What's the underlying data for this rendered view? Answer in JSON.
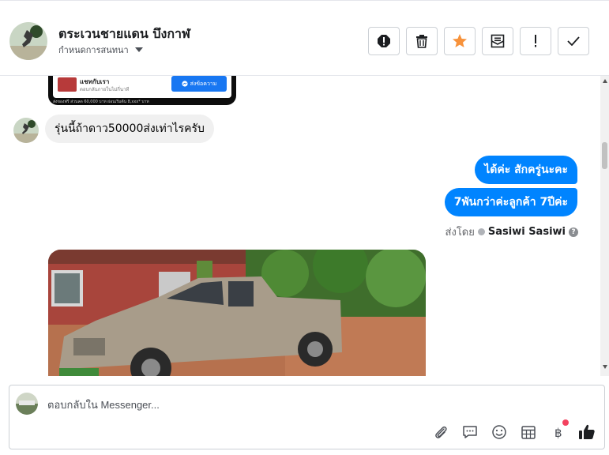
{
  "header": {
    "page_name": "ตระเวนชายแดน บึงกาฬ",
    "subtitle": "กำหนดการสนทนา",
    "actions": [
      {
        "icon": "alert-circle-icon",
        "name": "mark-spam-button"
      },
      {
        "icon": "trash-icon",
        "name": "delete-button"
      },
      {
        "icon": "star-icon",
        "name": "star-button",
        "color": "#f7923b"
      },
      {
        "icon": "mark-unread-icon",
        "name": "mark-unread-button"
      },
      {
        "icon": "exclamation-icon",
        "name": "follow-up-button"
      },
      {
        "icon": "check-icon",
        "name": "mark-done-button"
      }
    ]
  },
  "ad": {
    "title": "แชทกับเรา",
    "desc": "ตอบกลับภายในไม่กี่นาที",
    "button": "ส่งข้อความ",
    "footer": "ส่งของฟรี   ส่วนลด 60,000 บาท   ผ่อนเริ่มต้น 8,xxx* บาท"
  },
  "messages": {
    "incoming_1": "รุ่นนี้ถ้าดาว50000ส่งเท่าไรครับ",
    "outgoing_1": "ได้ค่ะ สักครู่นะคะ",
    "outgoing_2": "7พันกว่าค่ะลูกค้า 7ปีค่ะ",
    "sent_by_label": "ส่งโดย",
    "sent_by_name": "Sasiwi Sasiwi"
  },
  "composer": {
    "placeholder": "ตอบกลับใน Messenger...",
    "tools": [
      "attach-icon",
      "saved-replies-icon",
      "emoji-icon",
      "appointment-icon",
      "payment-icon",
      "like-icon"
    ]
  },
  "colors": {
    "outgoing_bubble": "#0084ff",
    "incoming_bubble": "#f0f0f0",
    "star": "#f7923b",
    "badge": "#f3425f"
  }
}
